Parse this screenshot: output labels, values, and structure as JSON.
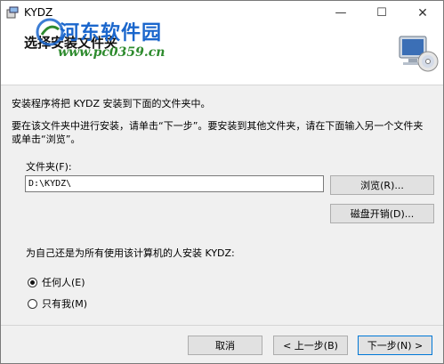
{
  "window": {
    "title": "KYDZ",
    "min_glyph": "—",
    "max_glyph": "☐",
    "close_glyph": "✕"
  },
  "watermark": {
    "name": "河东软件园",
    "url": "www.pc0359.cn"
  },
  "header": {
    "title": "选择安装文件夹"
  },
  "body": {
    "line1": "安装程序将把 KYDZ 安装到下面的文件夹中。",
    "line2": "要在该文件夹中进行安装，请单击“下一步”。要安装到其他文件夹，请在下面输入另一个文件夹或单击“浏览”。",
    "folder_label": "文件夹(F):",
    "folder_value": "D:\\KYDZ\\",
    "browse_label": "浏览(R)...",
    "disk_cost_label": "磁盘开销(D)...",
    "install_for_label": "为自己还是为所有使用该计算机的人安装 KYDZ:",
    "radio_everyone": "任何人(E)",
    "radio_me": "只有我(M)",
    "selected": "everyone"
  },
  "footer": {
    "cancel_label": "取消",
    "back_label": "< 上一步(B)",
    "next_label": "下一步(N) >"
  },
  "icons": {
    "app": "installer-icon",
    "computer": "computer-disc-icon"
  },
  "colors": {
    "watermark_blue": "#1a66cc",
    "watermark_green": "#2e8b2e",
    "focus_border": "#0078d7"
  }
}
